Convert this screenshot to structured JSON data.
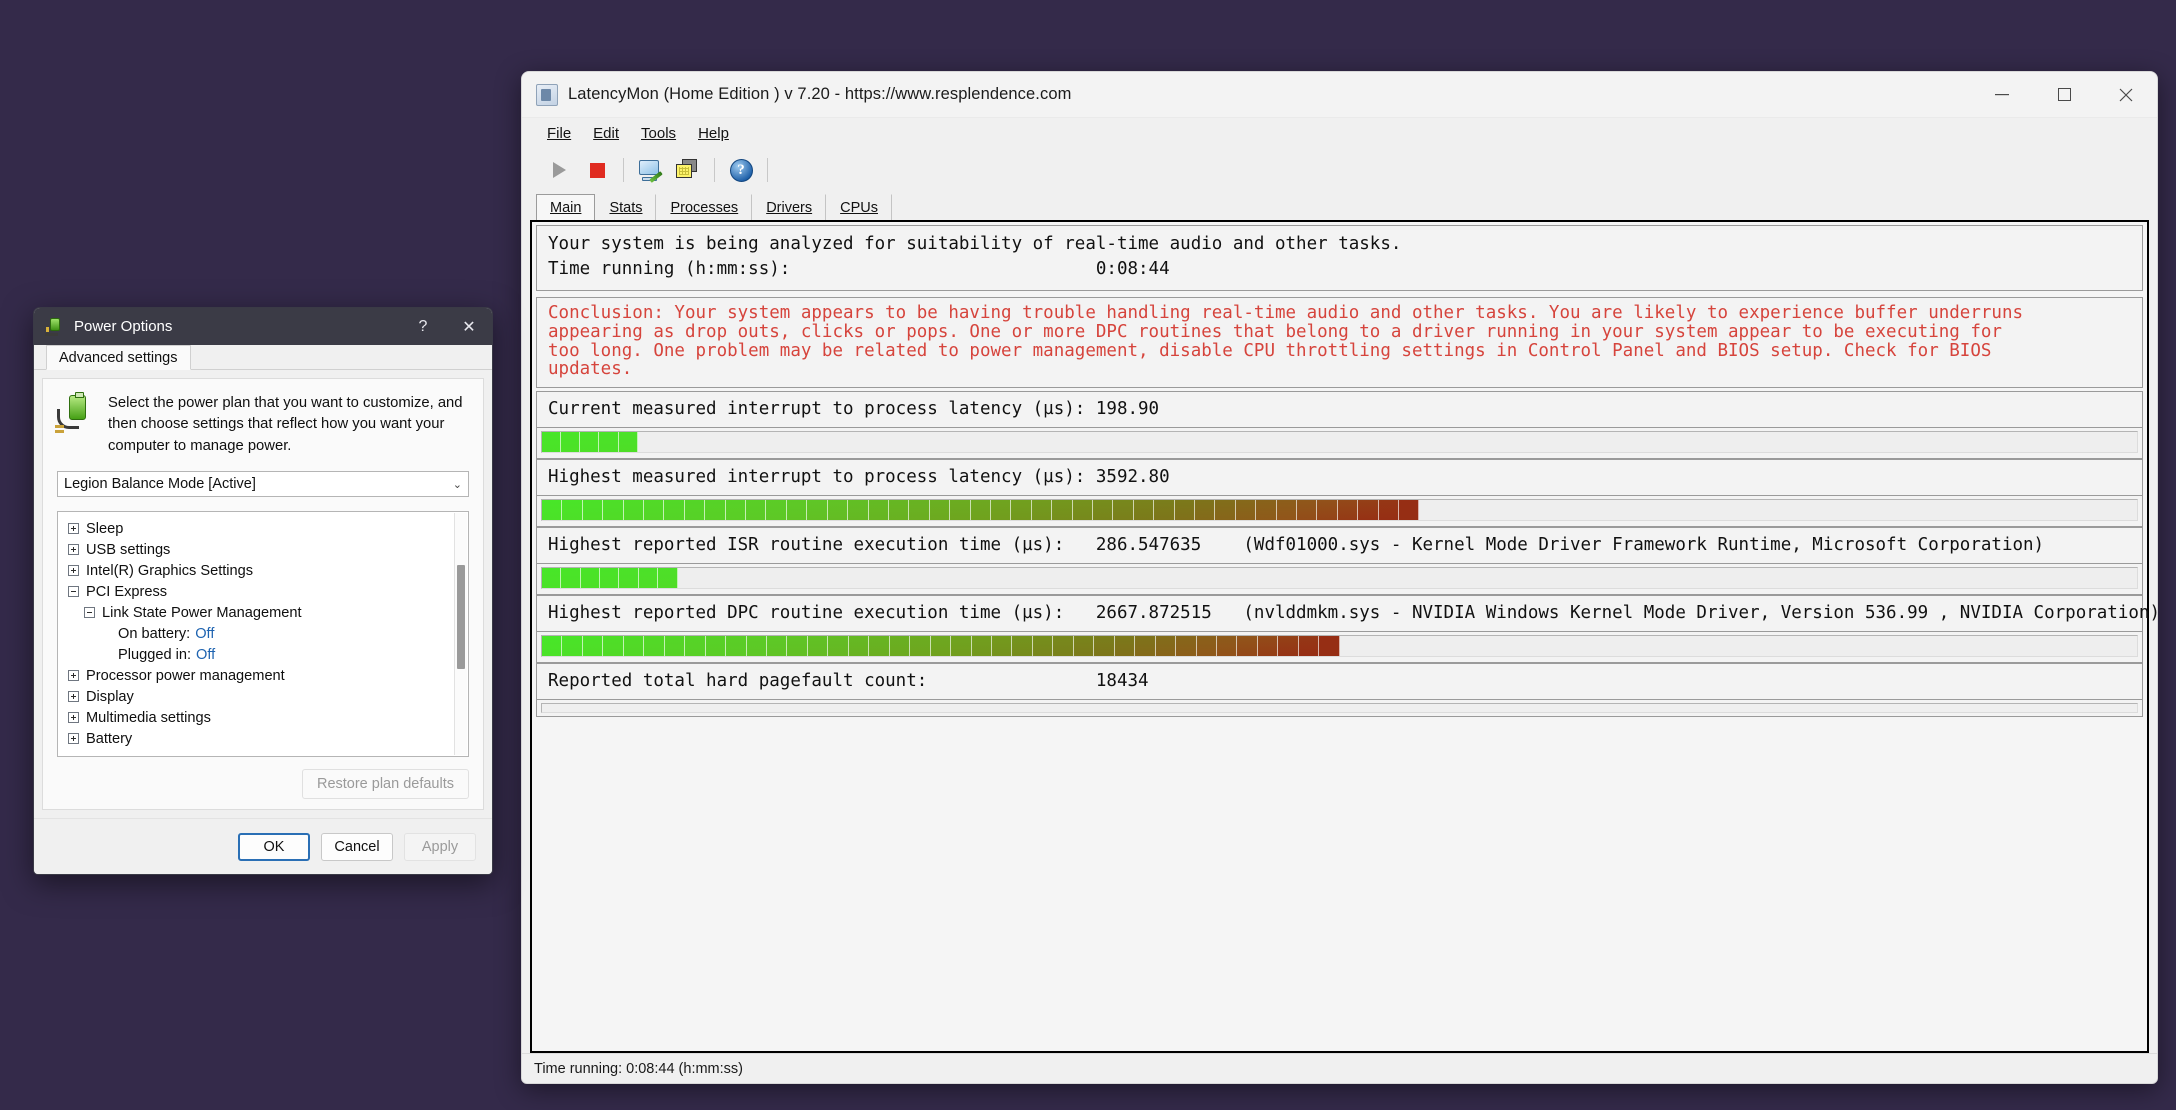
{
  "latencymon": {
    "title": "LatencyMon  (Home Edition )  v 7.20 - https://www.resplendence.com",
    "window_controls": {
      "minimize": "minimize-icon",
      "maximize": "maximize-icon",
      "close": "close-icon"
    },
    "menu": [
      "File",
      "Edit",
      "Tools",
      "Help"
    ],
    "toolbar": [
      {
        "name": "start-button",
        "icon": "play-icon"
      },
      {
        "name": "stop-button",
        "icon": "stop-icon"
      },
      {
        "name": "report-button",
        "icon": "report-icon"
      },
      {
        "name": "windows-button",
        "icon": "cascade-windows-icon"
      },
      {
        "name": "help-button",
        "icon": "help-icon"
      }
    ],
    "tabs": [
      {
        "label": "Main",
        "active": true
      },
      {
        "label": "Stats",
        "active": false
      },
      {
        "label": "Processes",
        "active": false
      },
      {
        "label": "Drivers",
        "active": false
      },
      {
        "label": "CPUs",
        "active": false
      }
    ],
    "header": {
      "line1": "Your system is being analyzed for suitability of real-time audio and other tasks.",
      "line2_label": "Time running (h:mm:ss):",
      "line2_value": "0:08:44"
    },
    "conclusion": {
      "color": "#d6443c",
      "lines": [
        "Conclusion: Your system appears to be having trouble handling real-time audio and other tasks. You are likely to experience buffer underruns",
        "appearing as drop outs, clicks or pops. One or more DPC routines that belong to a driver running in your system appear to be executing for",
        "too long. One problem may be related to power management, disable CPU throttling settings in Control Panel and BIOS setup. Check for BIOS",
        "updates."
      ]
    },
    "metrics": [
      {
        "label": "Current measured interrupt to process latency (µs):",
        "value": "198.90",
        "extra": "",
        "fill_percent": 6,
        "segments": 5
      },
      {
        "label": "Highest measured interrupt to process latency (µs):",
        "value": "3592.80",
        "extra": "",
        "fill_percent": 55,
        "segments": 43
      },
      {
        "label": "Highest reported ISR routine execution time (µs):",
        "value": "286.547635",
        "extra": "(Wdf01000.sys - Kernel Mode Driver Framework Runtime, Microsoft Corporation)",
        "fill_percent": 8.5,
        "segments": 7
      },
      {
        "label": "Highest reported DPC routine execution time (µs):",
        "value": "2667.872515",
        "extra": "(nvlddmkm.sys - NVIDIA Windows Kernel Mode Driver, Version 536.99 , NVIDIA Corporation)",
        "fill_percent": 50,
        "segments": 39
      }
    ],
    "pagefault": {
      "label": "Reported total hard pagefault count:",
      "value": "18434"
    },
    "statusbar": "Time running: 0:08:44  (h:mm:ss)"
  },
  "power_options": {
    "title": "Power Options",
    "help_glyph": "?",
    "close_glyph": "✕",
    "tab": "Advanced settings",
    "description": "Select the power plan that you want to customize, and then choose settings that reflect how you want your computer to manage power.",
    "plan_selected": "Legion Balance Mode [Active]",
    "caret": "⌄",
    "tree": [
      {
        "label": "Sleep",
        "indent": 0,
        "state": "collapsed"
      },
      {
        "label": "USB settings",
        "indent": 0,
        "state": "collapsed"
      },
      {
        "label": "Intel(R) Graphics Settings",
        "indent": 0,
        "state": "collapsed"
      },
      {
        "label": "PCI Express",
        "indent": 0,
        "state": "expanded"
      },
      {
        "label": "Link State Power Management",
        "indent": 1,
        "state": "expanded"
      },
      {
        "label": "On battery:",
        "indent": 2,
        "state": "none",
        "value": "Off"
      },
      {
        "label": "Plugged in:",
        "indent": 2,
        "state": "none",
        "value": "Off"
      },
      {
        "label": "Processor power management",
        "indent": 0,
        "state": "collapsed"
      },
      {
        "label": "Display",
        "indent": 0,
        "state": "collapsed"
      },
      {
        "label": "Multimedia settings",
        "indent": 0,
        "state": "collapsed"
      },
      {
        "label": "Battery",
        "indent": 0,
        "state": "collapsed"
      }
    ],
    "restore_button": "Restore plan defaults",
    "buttons": [
      {
        "label": "OK",
        "style": "primary"
      },
      {
        "label": "Cancel",
        "style": "normal"
      },
      {
        "label": "Apply",
        "style": "disabled"
      }
    ]
  }
}
